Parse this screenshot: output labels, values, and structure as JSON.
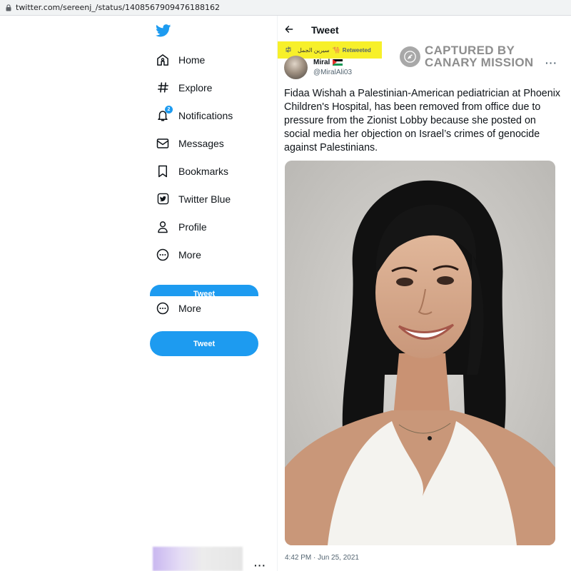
{
  "browser": {
    "url": "twitter.com/sereenj_/status/1408567909476188162"
  },
  "nav": {
    "items": [
      {
        "label": "Home",
        "icon": "home-icon"
      },
      {
        "label": "Explore",
        "icon": "hashtag-icon"
      },
      {
        "label": "Notifications",
        "icon": "bell-icon",
        "badge": "2"
      },
      {
        "label": "Messages",
        "icon": "envelope-icon"
      },
      {
        "label": "Bookmarks",
        "icon": "bookmark-icon"
      },
      {
        "label": "Twitter Blue",
        "icon": "twitter-blue-icon"
      },
      {
        "label": "Profile",
        "icon": "person-icon"
      },
      {
        "label": "More",
        "icon": "more-circle-icon"
      }
    ],
    "ghost_button_label": "Tweet",
    "more_label": "More",
    "tweet_button_label": "Tweet",
    "account_more": "···"
  },
  "header": {
    "title": "Tweet"
  },
  "retweet": {
    "retweeter": "سيرين الجمل",
    "label": "Retweeted"
  },
  "watermark": {
    "line1": "CAPTURED BY",
    "line2": "CANARY MISSION"
  },
  "tweet": {
    "author_name": "Miral",
    "author_handle": "@MiralAli03",
    "text": "Fidaa Wishah a Palestinian-American pediatrician at Phoenix Children's Hospital, has been removed from office due to pressure from the Zionist Lobby because she posted on social media her objection on Israel’s crimes of genocide against Palestinians.",
    "timestamp": "4:42 PM · Jun 25, 2021",
    "more": "···"
  },
  "colors": {
    "twitter_blue": "#1d9bf0",
    "highlight_yellow": "#f7f02a",
    "watermark_grey": "#8e8e8e"
  }
}
